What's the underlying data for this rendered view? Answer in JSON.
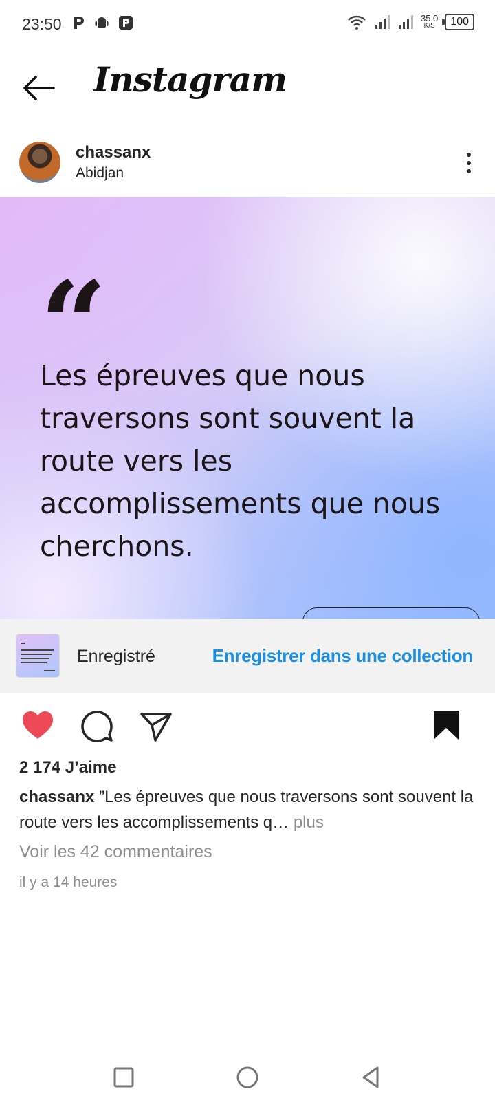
{
  "status_bar": {
    "time": "23:50",
    "net_speed_value": "35,0",
    "net_speed_unit": "K/S",
    "battery": "100",
    "icons": [
      "p-app-icon",
      "android-icon",
      "p-app-icon",
      "wifi-icon",
      "signal-icon",
      "signal-icon"
    ]
  },
  "header": {
    "title": "Instagram"
  },
  "post": {
    "username": "chassanx",
    "location": "Abidjan",
    "quote": "Les épreuves que nous traversons sont souvent la route vers les accomplissements que nous cherchons.",
    "quote_mark": "“"
  },
  "saved_banner": {
    "label": "Enregistré",
    "link": "Enregistrer dans une collection"
  },
  "stats": {
    "likes": "2 174 J’aime",
    "caption_user": "chassanx",
    "caption_text": " ”Les épreuves que nous traversons sont souvent la route vers les accomplissements q…",
    "more": " plus",
    "comments": "Voir les 42 commentaires",
    "time_ago": "il y a 14 heures"
  },
  "colors": {
    "like_red": "#ed4956",
    "link_blue": "#1b8fe0",
    "muted_gray": "#8e8e8e"
  }
}
